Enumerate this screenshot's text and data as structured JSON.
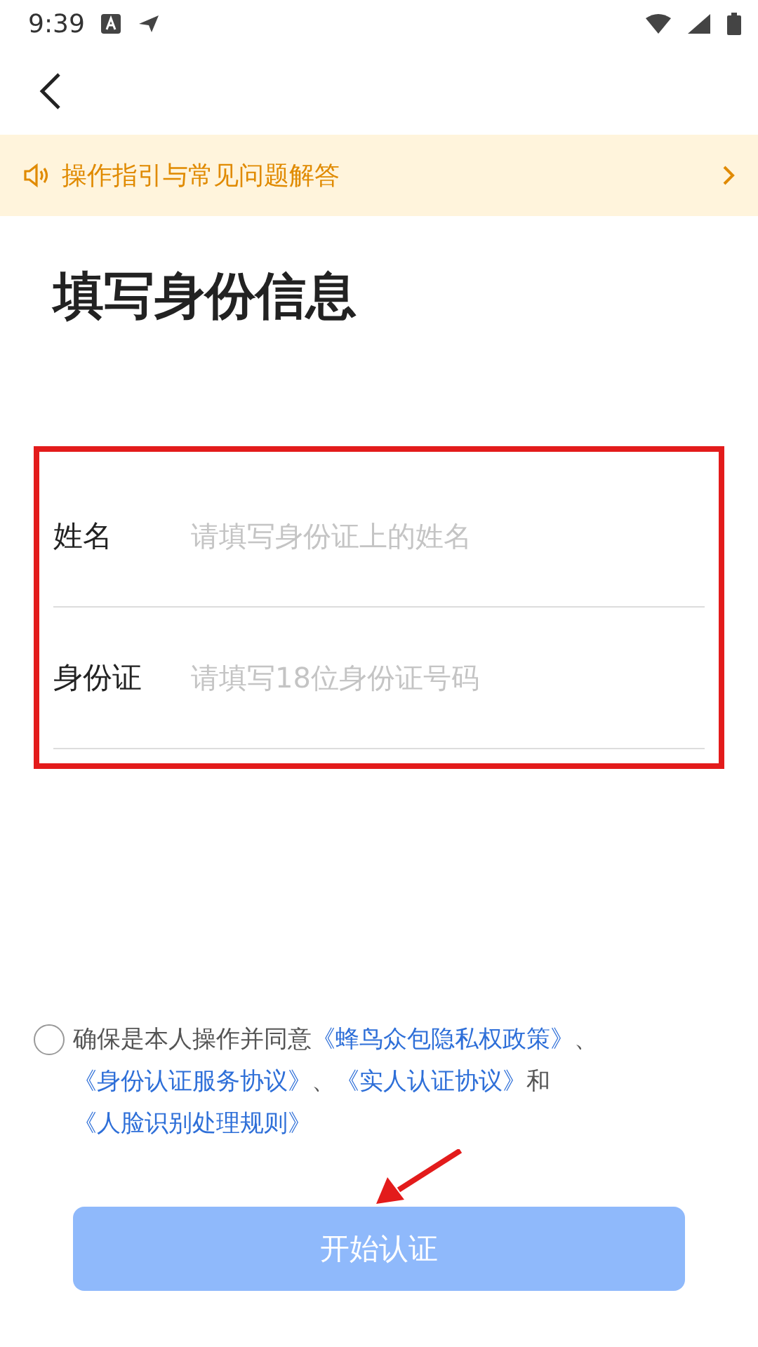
{
  "status_bar": {
    "time": "9:39"
  },
  "guide_banner": {
    "text": "操作指引与常见问题解答"
  },
  "title": "填写身份信息",
  "form": {
    "highlighted": true,
    "fields": [
      {
        "label": "姓名",
        "placeholder": "请填写身份证上的姓名"
      },
      {
        "label": "身份证",
        "placeholder": "请填写18位身份证号码"
      }
    ]
  },
  "agreement": {
    "checked": false,
    "segments": [
      {
        "kind": "text",
        "text": "确保是本人操作并同意"
      },
      {
        "kind": "link",
        "text": "《蜂鸟众包隐私权政策》"
      },
      {
        "kind": "text",
        "text": "、"
      },
      {
        "kind": "link",
        "text": "《身份认证服务协议》"
      },
      {
        "kind": "text",
        "text": "、"
      },
      {
        "kind": "link",
        "text": "《实人认证协议》"
      },
      {
        "kind": "text",
        "text": "和"
      },
      {
        "kind": "link",
        "text": "《人脸识别处理规则》"
      }
    ]
  },
  "start_button": {
    "label": "开始认证",
    "disabled": true
  },
  "arrow_annotation": true
}
